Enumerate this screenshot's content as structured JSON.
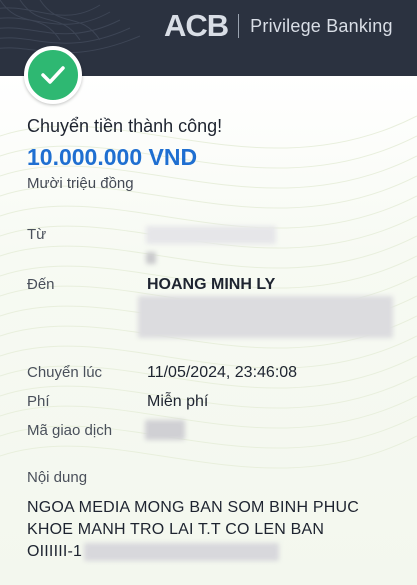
{
  "header": {
    "brand_logo": "ACB",
    "brand_tagline": "Privilege Banking"
  },
  "receipt": {
    "status_icon": "check-icon",
    "title": "Chuyển tiền thành công!",
    "amount": "10.000.000 VND",
    "amount_words": "Mười triệu đồng"
  },
  "details": {
    "from_label": "Từ",
    "to_label": "Đến",
    "to_name": "HOANG MINH LY",
    "time_label": "Chuyển lúc",
    "time_value": "11/05/2024, 23:46:08",
    "fee_label": "Phí",
    "fee_value": "Miễn phí",
    "txn_label": "Mã giao dịch"
  },
  "content": {
    "label": "Nội dung",
    "line1": "NGOA MEDIA MONG BAN SOM BINH PHUC",
    "line2": "KHOE MANH TRO LAI T.T CO LEN BAN",
    "line3_prefix": "OIIIIII-1"
  },
  "colors": {
    "header_bg": "#2b3240",
    "success_green": "#2eb872",
    "amount_blue": "#1f6fd1"
  }
}
